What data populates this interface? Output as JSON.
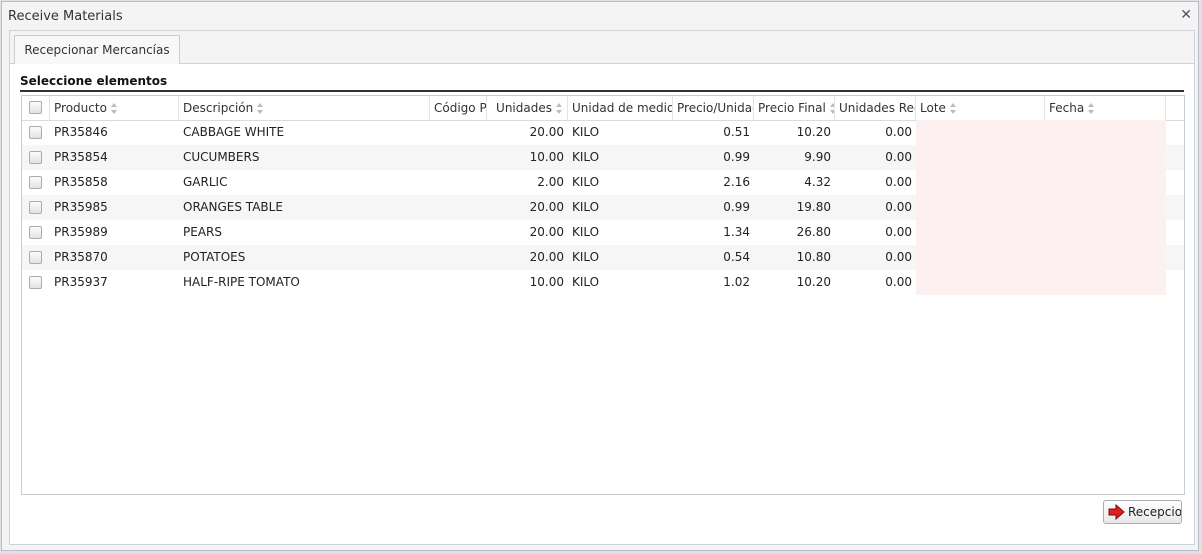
{
  "window": {
    "title": "Receive Materials"
  },
  "tabs": [
    {
      "label": "Recepcionar Mercancías"
    }
  ],
  "section": {
    "title": "Seleccione elementos"
  },
  "grid": {
    "columns": [
      {
        "key": "product",
        "label": "Producto",
        "sortable": true
      },
      {
        "key": "description",
        "label": "Descripción",
        "sortable": true
      },
      {
        "key": "code",
        "label": "Código Pr",
        "sortable": false
      },
      {
        "key": "units",
        "label": "Unidades",
        "sortable": true
      },
      {
        "key": "uom",
        "label": "Unidad de medida",
        "sortable": false
      },
      {
        "key": "unit_price",
        "label": "Precio/Unidad",
        "sortable": false
      },
      {
        "key": "final_price",
        "label": "Precio Final",
        "sortable": true
      },
      {
        "key": "received",
        "label": "Unidades Reci",
        "sortable": false
      },
      {
        "key": "lot",
        "label": "Lote",
        "sortable": true
      },
      {
        "key": "date",
        "label": "Fecha",
        "sortable": true
      }
    ],
    "rows": [
      {
        "product": "PR35846",
        "description": "CABBAGE WHITE",
        "code": "",
        "units": "20.00",
        "uom": "KILO",
        "unit_price": "0.51",
        "final_price": "10.20",
        "received": "0.00",
        "lot": "",
        "date": ""
      },
      {
        "product": "PR35854",
        "description": "CUCUMBERS",
        "code": "",
        "units": "10.00",
        "uom": "KILO",
        "unit_price": "0.99",
        "final_price": "9.90",
        "received": "0.00",
        "lot": "",
        "date": ""
      },
      {
        "product": "PR35858",
        "description": "GARLIC",
        "code": "",
        "units": "2.00",
        "uom": "KILO",
        "unit_price": "2.16",
        "final_price": "4.32",
        "received": "0.00",
        "lot": "",
        "date": ""
      },
      {
        "product": "PR35985",
        "description": "ORANGES TABLE",
        "code": "",
        "units": "20.00",
        "uom": "KILO",
        "unit_price": "0.99",
        "final_price": "19.80",
        "received": "0.00",
        "lot": "",
        "date": ""
      },
      {
        "product": "PR35989",
        "description": "PEARS",
        "code": "",
        "units": "20.00",
        "uom": "KILO",
        "unit_price": "1.34",
        "final_price": "26.80",
        "received": "0.00",
        "lot": "",
        "date": ""
      },
      {
        "product": "PR35870",
        "description": "POTATOES",
        "code": "",
        "units": "20.00",
        "uom": "KILO",
        "unit_price": "0.54",
        "final_price": "10.80",
        "received": "0.00",
        "lot": "",
        "date": ""
      },
      {
        "product": "PR35937",
        "description": "HALF-RIPE TOMATO",
        "code": "",
        "units": "10.00",
        "uom": "KILO",
        "unit_price": "1.02",
        "final_price": "10.20",
        "received": "0.00",
        "lot": "",
        "date": ""
      }
    ]
  },
  "actions": {
    "receive_label": "Recepcion"
  },
  "icons": {
    "close": "close-icon",
    "receive": "red-arrow-icon",
    "sort": "sort-icon"
  },
  "colors": {
    "editable_cell": "#fdf0f0",
    "alt_row": "#f6f6f6",
    "arrow": "#e02020"
  }
}
